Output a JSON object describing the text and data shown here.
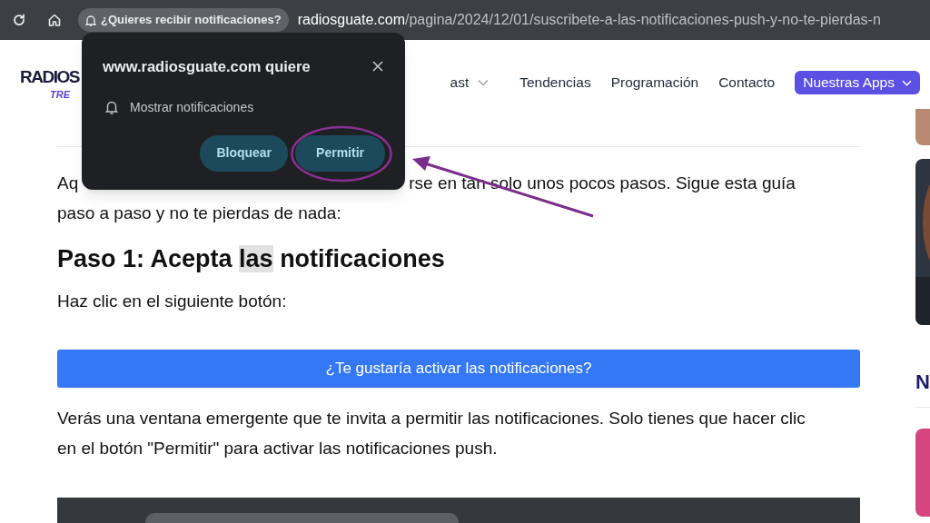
{
  "browser": {
    "chip": "¿Quieres recibir notificaciones?",
    "url_domain": "radiosguate.com",
    "url_path": "/pagina/2024/12/01/suscribete-a-las-notificaciones-push-y-no-te-pierdas-n"
  },
  "popup": {
    "title": "www.radiosguate.com quiere",
    "permission": "Mostrar notificaciones",
    "buttons": [
      {
        "label": "Bloquear",
        "highlighted": false
      },
      {
        "label": "Permitir",
        "highlighted": true
      }
    ]
  },
  "header": {
    "logo": "RADIOS",
    "logo_sub": "TRE",
    "nav": [
      {
        "label": "ast",
        "dropdown": true
      },
      {
        "label": "Tendencias",
        "dropdown": false
      },
      {
        "label": "Programación",
        "dropdown": false
      },
      {
        "label": "Contacto",
        "dropdown": false
      }
    ],
    "apps_button": "Nuestras Apps"
  },
  "article": {
    "intro_start": "Aq",
    "intro_visible": "rse en tan solo unos pocos pasos. Sigue esta guía",
    "intro_line2": "paso a paso y no te pierdas de nada:",
    "heading": [
      {
        "text": "Paso 1: Acepta ",
        "highlighted": false
      },
      {
        "text": "las",
        "highlighted": true
      },
      {
        "text": " notificaciones",
        "highlighted": false
      }
    ],
    "instruction": "Haz clic en el siguiente botón:",
    "cta": "¿Te gustaría activar las notificaciones?",
    "explanation": "Verás una ventana emergente que te invita a permitir las notificaciones. Solo tienes que hacer clic en el botón \"Permitir\" para activar las notificaciones push."
  },
  "sidebar": {
    "heading": "N"
  }
}
